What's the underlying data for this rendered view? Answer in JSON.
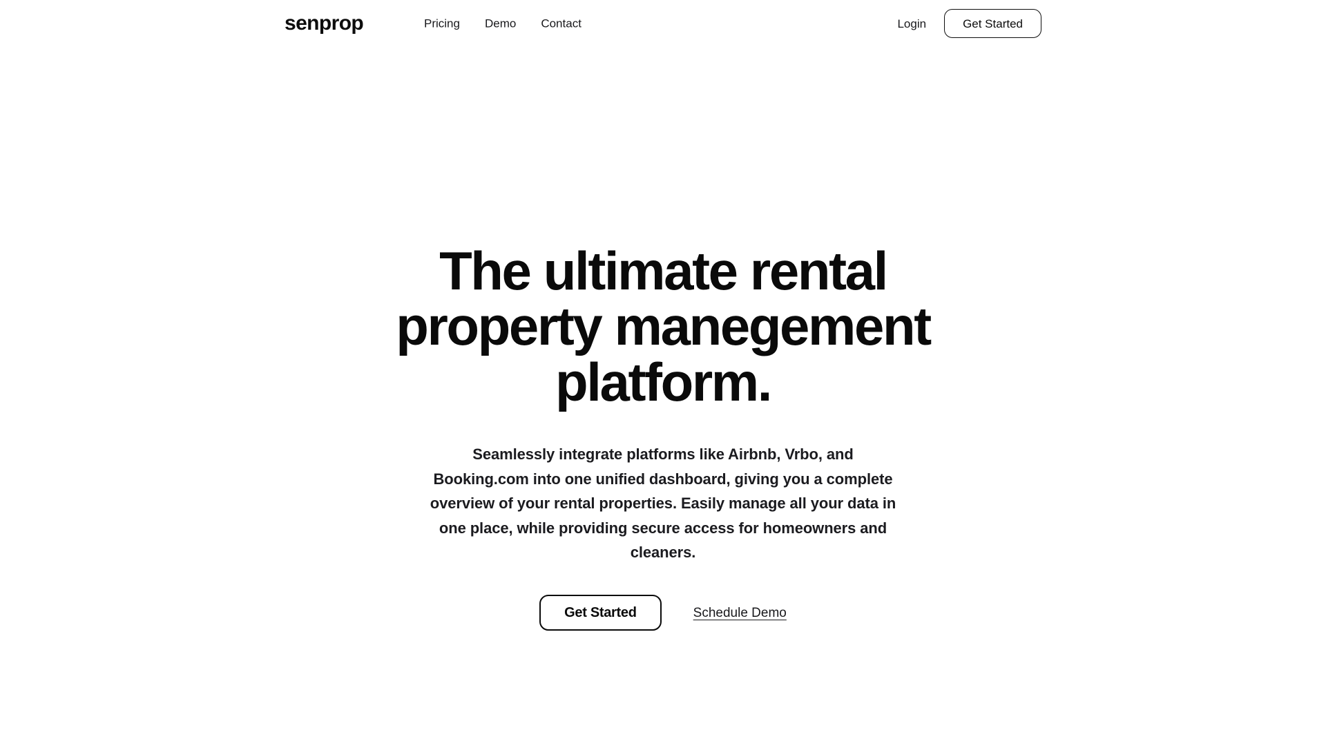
{
  "brand": {
    "name": "senprop"
  },
  "header": {
    "nav": [
      {
        "label": "Pricing"
      },
      {
        "label": "Demo"
      },
      {
        "label": "Contact"
      }
    ],
    "login_label": "Login",
    "cta_label": "Get Started"
  },
  "hero": {
    "title": "The ultimate rental property manegement platform.",
    "subtitle": "Seamlessly integrate platforms like Airbnb, Vrbo, and Booking.com into one unified dashboard, giving you a complete overview of your rental properties. Easily manage all your data in one place, while providing secure access for homeowners and cleaners.",
    "primary_cta_label": "Get Started",
    "secondary_cta_label": "Schedule Demo"
  },
  "colors": {
    "background": "#ffffff",
    "text": "#111111",
    "border": "#0d0d0d"
  }
}
